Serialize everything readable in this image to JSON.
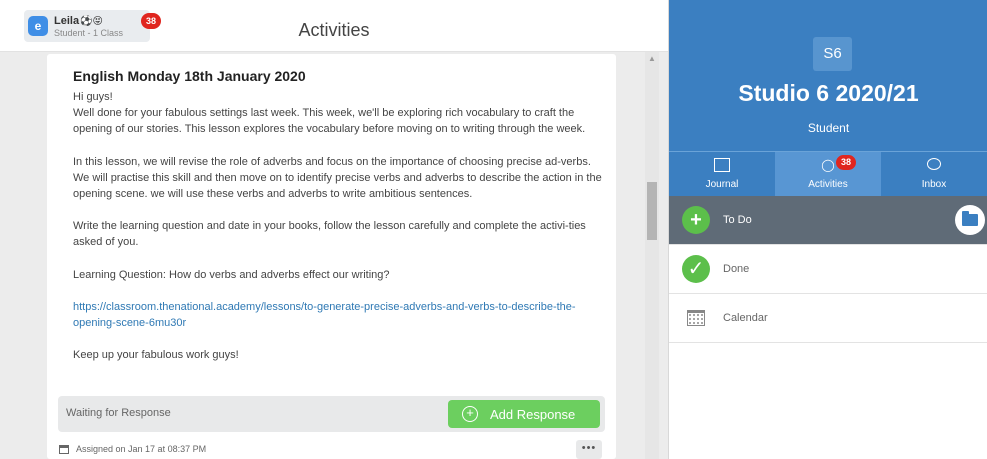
{
  "header": {
    "user_name": "Leila",
    "user_emoji": "⚽😝",
    "user_role": "Student - 1 Class",
    "user_avatar": "e",
    "notification_count": "38",
    "page_title": "Activities"
  },
  "post": {
    "title": "English Monday 18th January 2020",
    "paragraphs": [
      "Hi guys!",
      "Well done for your fabulous settings last week. This week, we'll be exploring rich vocabulary to craft the opening of our stories. This lesson explores the vocabulary before moving on to writing through the week.",
      "In this lesson, we will revise the role of adverbs and focus on the importance of choosing precise ad-verbs. We will practise this skill and then move on to identify precise verbs and adverbs to describe the action in the opening scene. we will use these verbs and adverbs to write ambitious sentences.",
      "Write the learning question and date in your books, follow the lesson carefully and complete the activi-ties asked of you.",
      "Learning Question: How do verbs and adverbs effect our writing?",
      "https://classroom.thenational.academy/lessons/to-generate-precise-adverbs-and-verbs-to-describe-the-opening-scene-6mu30r",
      "Keep up your fabulous work guys!"
    ],
    "waiting_text": "Waiting for Response",
    "add_response_label": "Add Response",
    "assigned_text": "Assigned on Jan 17 at 08:37 PM",
    "more_label": "•••"
  },
  "sidebar": {
    "class_icon": "S6",
    "class_name": "Studio 6 2020/21",
    "class_role": "Student",
    "tabs": [
      {
        "label": "Journal",
        "icon": "book-icon"
      },
      {
        "label": "Activities",
        "icon": "lightbulb-icon",
        "badge": "38"
      },
      {
        "label": "Inbox",
        "icon": "chat-bubbles-icon"
      }
    ],
    "nav": [
      {
        "label": "To Do",
        "icon": "plus-circle-icon"
      },
      {
        "label": "Done",
        "icon": "check-circle-icon"
      },
      {
        "label": "Calendar",
        "icon": "calendar-icon"
      }
    ]
  },
  "colors": {
    "brand_blue": "#3b7fc1",
    "active_row": "#5f6b77",
    "green": "#5cbf4b",
    "badge_red": "#e0261f",
    "link": "#2f79b4"
  }
}
